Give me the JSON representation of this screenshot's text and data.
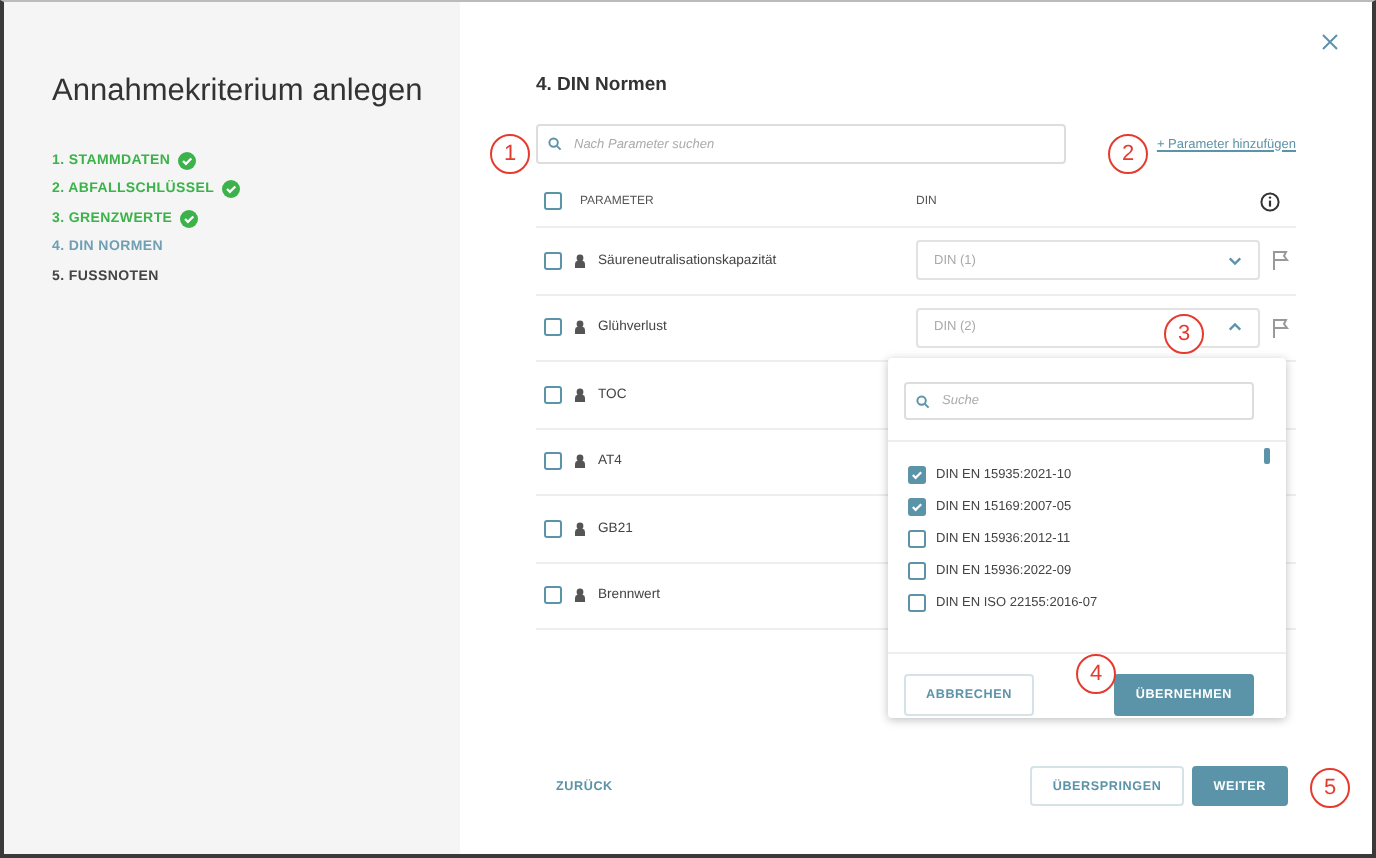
{
  "sidebar": {
    "title": "Annahmekriterium anlegen",
    "steps": [
      {
        "label": "1. STAMMDATEN",
        "kind": "done"
      },
      {
        "label": "2. ABFALLSCHLÜSSEL",
        "kind": "done"
      },
      {
        "label": "3. GRENZWERTE",
        "kind": "done"
      },
      {
        "label": "4. DIN NORMEN",
        "kind": "active"
      },
      {
        "label": "5. FUSSNOTEN",
        "kind": "pending"
      }
    ]
  },
  "main": {
    "title": "4. DIN Normen",
    "search": {
      "placeholder": "Nach Parameter suchen"
    },
    "add_link": "+ Parameter hinzufügen",
    "table": {
      "columns": [
        "PARAMETER",
        "DIN"
      ],
      "header_checked": false,
      "rows": [
        {
          "name": "Säureneutralisationskapazität",
          "din": "DIN (1)",
          "expanded": false,
          "checked": false
        },
        {
          "name": "Glühverlust",
          "din": "DIN (2)",
          "expanded": true,
          "checked": false
        },
        {
          "name": "TOC",
          "checked": false
        },
        {
          "name": "AT4",
          "checked": false
        },
        {
          "name": "GB21",
          "checked": false
        },
        {
          "name": "Brennwert",
          "checked": false
        }
      ]
    },
    "dropdown": {
      "search": {
        "placeholder": "Suche"
      },
      "options": [
        {
          "label": "DIN EN 15935:2021-10",
          "checked": true
        },
        {
          "label": "DIN EN 15169:2007-05",
          "checked": true
        },
        {
          "label": "DIN EN 15936:2012-11",
          "checked": false
        },
        {
          "label": "DIN EN 15936:2022-09",
          "checked": false
        },
        {
          "label": "DIN EN ISO 22155:2016-07",
          "checked": false
        }
      ],
      "buttons": [
        {
          "label": "ABBRECHEN",
          "kind": "secondary"
        },
        {
          "label": "ÜBERNEHMEN",
          "kind": "primary"
        }
      ]
    },
    "footer": {
      "back": "ZURÜCK",
      "buttons": [
        {
          "label": "ÜBERSPRINGEN",
          "kind": "secondary"
        },
        {
          "label": "WEITER",
          "kind": "primary"
        }
      ]
    }
  },
  "annotations": [
    "1",
    "2",
    "3",
    "4",
    "5"
  ]
}
